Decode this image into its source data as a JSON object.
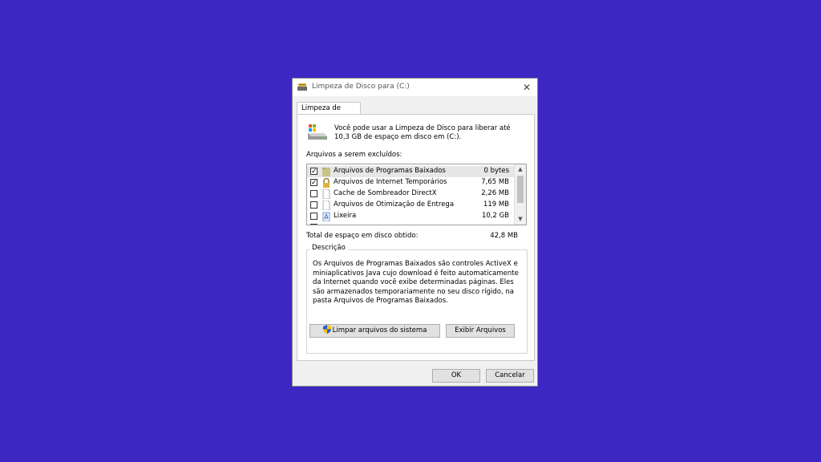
{
  "window": {
    "title": "Limpeza de Disco para  (C:)",
    "close_glyph": "✕"
  },
  "tab": {
    "label": "Limpeza de Disco"
  },
  "intro": {
    "text": "Você pode usar a Limpeza de Disco para liberar até 10,3 GB de espaço em disco em  (C:)."
  },
  "files": {
    "label": "Arquivos a serem excluídos:",
    "items": [
      {
        "name": "Arquivos de Programas Baixados",
        "size": "0 bytes",
        "checked": true,
        "icon": "folder-icon"
      },
      {
        "name": "Arquivos de Internet Temporários",
        "size": "7,65 MB",
        "checked": true,
        "icon": "lock-icon"
      },
      {
        "name": "Cache de Sombreador DirectX",
        "size": "2,26 MB",
        "checked": false,
        "icon": "file-icon"
      },
      {
        "name": "Arquivos de Otimização de Entrega",
        "size": "119 MB",
        "checked": false,
        "icon": "file-icon"
      },
      {
        "name": "Lixeira",
        "size": "10,2 GB",
        "checked": false,
        "icon": "recycle-bin-icon"
      }
    ]
  },
  "total": {
    "label": "Total de espaço em disco obtido:",
    "value": "42,8 MB"
  },
  "description": {
    "title": "Descrição",
    "text": "Os Arquivos de Programas Baixados são controles ActiveX e miniaplicativos Java cujo download é feito automaticamente da Internet quando você exibe determinadas páginas. Eles são armazenados temporariamente no seu disco rígido, na pasta Arquivos de Programas Baixados."
  },
  "buttons": {
    "clean_system": "Limpar arquivos do sistema",
    "view_files": "Exibir Arquivos",
    "ok": "OK",
    "cancel": "Cancelar"
  },
  "colors": {
    "background": "#3c27c2",
    "dialog": "#f0f0f0"
  }
}
